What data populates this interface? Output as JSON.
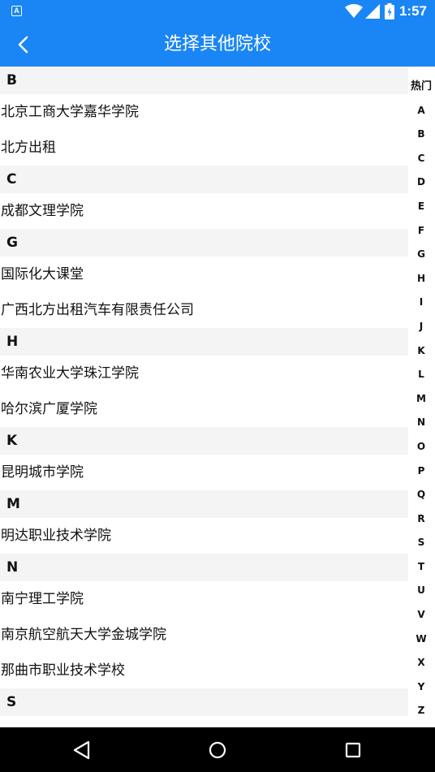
{
  "status_bar": {
    "app_icon_letter": "A",
    "time": "1:57"
  },
  "header": {
    "title": "选择其他院校"
  },
  "sections": [
    {
      "letter": "B",
      "items": [
        "北京工商大学嘉华学院",
        "北方出租"
      ]
    },
    {
      "letter": "C",
      "items": [
        "成都文理学院"
      ]
    },
    {
      "letter": "G",
      "items": [
        "国际化大课堂",
        "广西北方出租汽车有限责任公司"
      ]
    },
    {
      "letter": "H",
      "items": [
        "华南农业大学珠江学院",
        "哈尔滨广厦学院"
      ]
    },
    {
      "letter": "K",
      "items": [
        "昆明城市学院"
      ]
    },
    {
      "letter": "M",
      "items": [
        "明达职业技术学院"
      ]
    },
    {
      "letter": "N",
      "items": [
        "南宁理工学院",
        "南京航空航天大学金城学院",
        "那曲市职业技术学校"
      ]
    },
    {
      "letter": "S",
      "items": [
        ""
      ]
    }
  ],
  "index_bar": [
    "热门",
    "A",
    "B",
    "C",
    "D",
    "E",
    "F",
    "G",
    "H",
    "I",
    "J",
    "K",
    "L",
    "M",
    "N",
    "O",
    "P",
    "Q",
    "R",
    "S",
    "T",
    "U",
    "V",
    "W",
    "X",
    "Y",
    "Z"
  ],
  "icons": {
    "back": "chevron-left-icon",
    "wifi": "wifi-icon",
    "signal": "signal-icon",
    "battery": "battery-icon",
    "nav_back": "triangle-back-icon",
    "nav_home": "circle-home-icon",
    "nav_recents": "square-recents-icon"
  },
  "colors": {
    "primary": "#1a86f5",
    "section_bg": "#f4f4f4",
    "nav_bar": "#000000"
  }
}
